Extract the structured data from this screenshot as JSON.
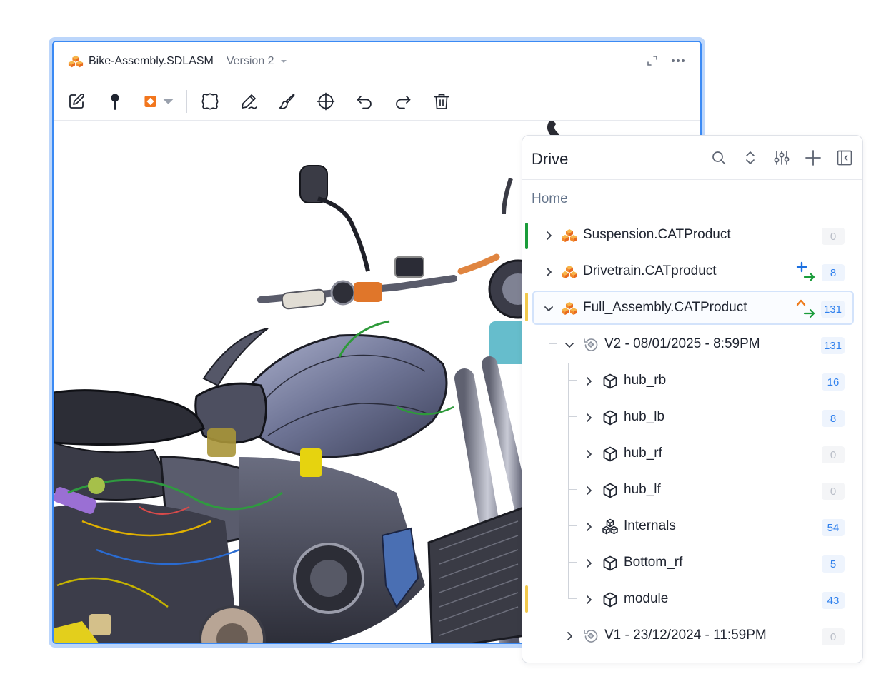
{
  "viewer": {
    "file_name": "Bike-Assembly.SDLASM",
    "version_label": "Version 2",
    "toolbar_icons": [
      "edit-icon",
      "pin-icon",
      "color-fill-icon",
      "lasso-select-icon",
      "pen-icon",
      "brush-icon",
      "crosshair-icon",
      "undo-icon",
      "redo-icon",
      "trash-icon"
    ]
  },
  "drive": {
    "title": "Drive",
    "breadcrumb": "Home",
    "actions": [
      "search-icon",
      "expand-collapse-icon",
      "filter-sliders-icon",
      "add-icon",
      "collapse-panel-icon"
    ],
    "items": [
      {
        "label": "Suspension.CATProduct",
        "count": "0",
        "status_color": "#1a9c3a"
      },
      {
        "label": "Drivetrain.CATproduct",
        "count": "8",
        "change": "added"
      },
      {
        "label": "Full_Assembly.CATProduct",
        "count": "131",
        "change": "modified",
        "status_color": "#f2c94c",
        "selected": true
      },
      {
        "label": "V2 - 08/01/2025 - 8:59PM",
        "count": "131"
      },
      {
        "label": "hub_rb",
        "count": "16"
      },
      {
        "label": "hub_lb",
        "count": "8"
      },
      {
        "label": "hub_rf",
        "count": "0"
      },
      {
        "label": "hub_lf",
        "count": "0"
      },
      {
        "label": "Internals",
        "count": "54"
      },
      {
        "label": "Bottom_rf",
        "count": "5"
      },
      {
        "label": "module",
        "count": "43",
        "status_color": "#f2c94c"
      },
      {
        "label": "V1 - 23/12/2024 - 11:59PM",
        "count": "0"
      }
    ]
  },
  "colors": {
    "accent": "#3b8af4",
    "badge_text": "#2f80ed",
    "added": "#1b6fe0",
    "modified": "#ee7a1a",
    "arrow_green": "#1a9c3a"
  }
}
